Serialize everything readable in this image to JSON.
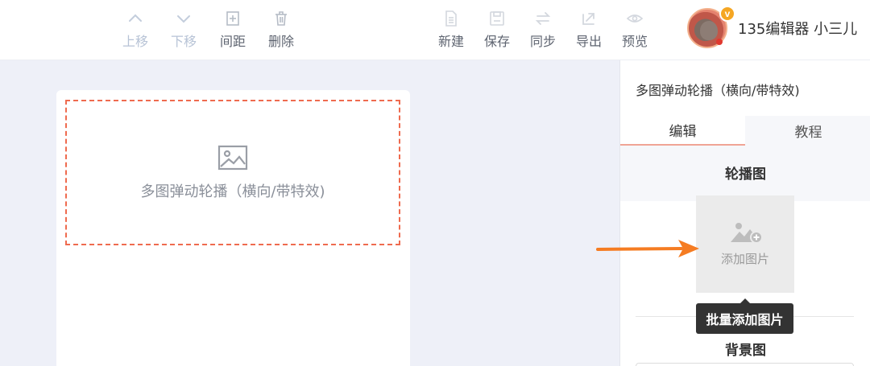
{
  "toolbar": {
    "move_up": "上移",
    "move_down": "下移",
    "spacing": "间距",
    "delete": "删除",
    "new": "新建",
    "save": "保存",
    "sync": "同步",
    "export": "导出",
    "preview": "预览"
  },
  "user": {
    "name": "135编辑器 小三儿",
    "badge": "v"
  },
  "canvas": {
    "placeholder_text": "多图弹动轮播（横向/带特效)"
  },
  "panel": {
    "title": "多图弹动轮播（横向/带特效)",
    "tabs": [
      {
        "label": "编辑",
        "active": true
      },
      {
        "label": "教程",
        "active": false
      }
    ],
    "carousel_title": "轮播图",
    "add_image": "添加图片",
    "batch_add": "批量添加图片",
    "background_title": "背景图"
  },
  "colors": {
    "accent": "#ef6b4f",
    "arrow": "#f57c22",
    "tooltip_bg": "#333333",
    "disabled_text": "#b7c3d6"
  },
  "icons": [
    "chevron-up-icon",
    "chevron-down-icon",
    "spacing-icon",
    "trash-icon",
    "new-file-icon",
    "save-icon",
    "sync-icon",
    "export-icon",
    "eye-icon",
    "image-icon",
    "add-image-icon"
  ]
}
